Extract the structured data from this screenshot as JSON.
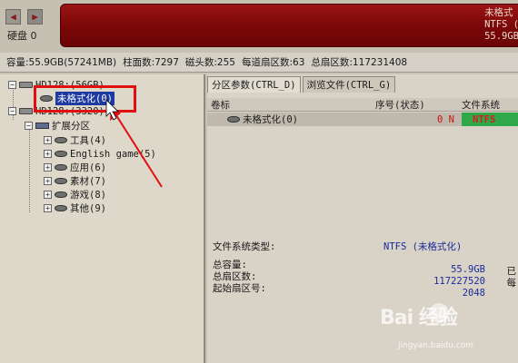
{
  "toolbar": {
    "disk_label": "硬盘 0",
    "disk_bar": {
      "partition_name": "未格式",
      "filesystem": "NTFS (",
      "size": "55.9GB"
    }
  },
  "infobar": {
    "capacity": "容量:55.9GB(57241MB)",
    "cylinders": "柱面数:7297",
    "heads": "磁头数:255",
    "sectors_per_track": "每道扇区数:63",
    "total_sectors": "总扇区数:117231408"
  },
  "tree": {
    "disk1": "HD128:(56GB)",
    "unformatted": "未格式化(0)",
    "disk2": "HD128:(3320)",
    "extended": "扩展分区",
    "items": [
      {
        "label": "工具(4)"
      },
      {
        "label": "English game(5)"
      },
      {
        "label": "应用(6)"
      },
      {
        "label": "素材(7)"
      },
      {
        "label": "游戏(8)"
      },
      {
        "label": "其他(9)"
      }
    ]
  },
  "tabs": [
    {
      "label": "分区参数(CTRL_D)"
    },
    {
      "label": "浏览文件(CTRL_G)"
    }
  ],
  "table": {
    "headers": {
      "name": "卷标",
      "num": "序号(状态)",
      "fs": "文件系统"
    },
    "row": {
      "name": "未格式化(0)",
      "num": "0 N",
      "fs": "NTFS"
    }
  },
  "details": {
    "fs_type_label": "文件系统类型:",
    "fs_type_value": "NTFS (未格式化)",
    "capacity_label": "总容量:",
    "capacity_value": "55.9GB",
    "sectors_label": "总扇区数:",
    "sectors_value": "117227520",
    "start_label": "起始扇区号:",
    "start_value": "2048",
    "side_1": "已",
    "side_2": "每"
  },
  "watermark": {
    "brand": "Bai 经验",
    "url": "jingyan.baidu.com"
  }
}
